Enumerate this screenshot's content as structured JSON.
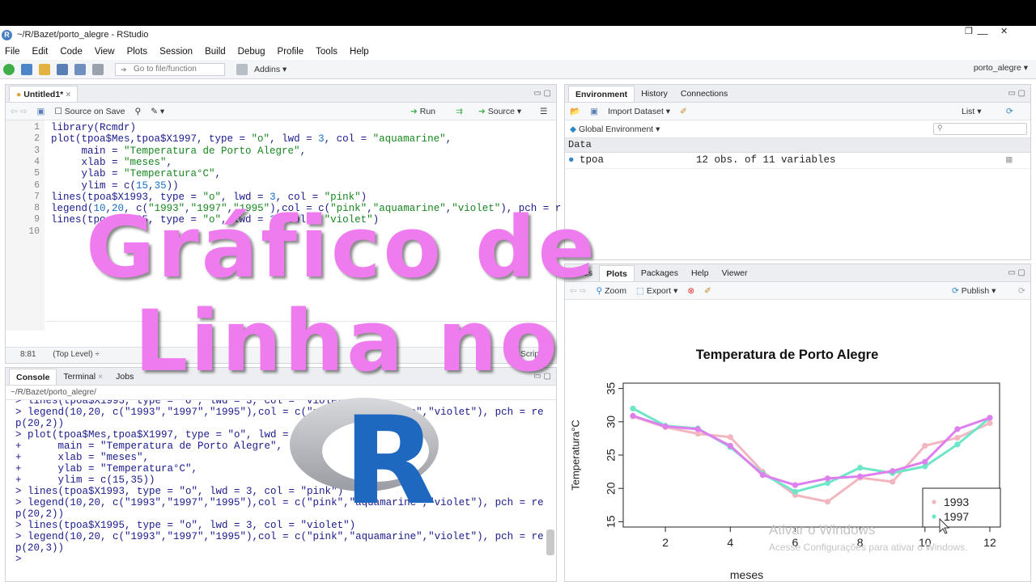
{
  "window": {
    "title": "~/R/Bazet/porto_alegre - RStudio",
    "minimize": "—",
    "maximize": "❐",
    "close": "✕"
  },
  "menu": [
    "File",
    "Edit",
    "Code",
    "View",
    "Plots",
    "Session",
    "Build",
    "Debug",
    "Profile",
    "Tools",
    "Help"
  ],
  "toolbar": {
    "goto_placeholder": "Go to file/function",
    "addins": "Addins ▾",
    "project": "porto_alegre ▾"
  },
  "editor": {
    "tab": "Untitled1*",
    "source_on_save": "Source on Save",
    "run": "Run",
    "source": "Source ▾",
    "lines": [
      {
        "n": "1",
        "code": "library(Rcmdr)"
      },
      {
        "n": "2",
        "code": "plot(tpoa$Mes,tpoa$X1997, type = \"o\", lwd = 3, col = \"aquamarine\","
      },
      {
        "n": "3",
        "code": "     main = \"Temperatura de Porto Alegre\","
      },
      {
        "n": "4",
        "code": "     xlab = \"meses\","
      },
      {
        "n": "5",
        "code": "     ylab = \"Temperatura°C\","
      },
      {
        "n": "6",
        "code": "     ylim = c(15,35))"
      },
      {
        "n": "7",
        "code": "lines(tpoa$X1993, type = \"o\", lwd = 3, col = \"pink\")"
      },
      {
        "n": "8",
        "code": "legend(10,20, c(\"1993\",\"1997\",\"1995\"),col = c(\"pink\",\"aquamarine\",\"violet\"), pch = r"
      },
      {
        "n": "9",
        "code": "lines(tpoa$X1995, type = \"o\", lwd = 3, col = \"violet\")"
      },
      {
        "n": "10",
        "code": ""
      }
    ],
    "status_pos": "8:81",
    "status_scope": "(Top Level) ÷",
    "status_type": "R Script ÷"
  },
  "console": {
    "tabs": [
      "Console",
      "Terminal",
      "Jobs"
    ],
    "path": "~/R/Bazet/porto_alegre/",
    "lines": [
      "> lines(tpoa$X1993, type = \"o\", lwd = 3, col = \"violet\")",
      "> legend(10,20, c(\"1993\",\"1997\",\"1995\"),col = c(\"pink\",\"aquamarine\",\"violet\"), pch = re",
      "p(20,2))",
      "> plot(tpoa$Mes,tpoa$X1997, type = \"o\", lwd = 3, col = \"aquamarine\",",
      "+      main = \"Temperatura de Porto Alegre\",",
      "+      xlab = \"meses\",",
      "+      ylab = \"Temperatura°C\",",
      "+      ylim = c(15,35))",
      "> lines(tpoa$X1993, type = \"o\", lwd = 3, col = \"pink\")",
      "> legend(10,20, c(\"1993\",\"1997\",\"1995\"),col = c(\"pink\",\"aquamarine\",\"violet\"), pch = re",
      "p(20,2))",
      "> lines(tpoa$X1995, type = \"o\", lwd = 3, col = \"violet\")",
      "> legend(10,20, c(\"1993\",\"1997\",\"1995\"),col = c(\"pink\",\"aquamarine\",\"violet\"), pch = re",
      "p(20,3))",
      "> "
    ]
  },
  "environment": {
    "tabs": [
      "Environment",
      "History",
      "Connections"
    ],
    "import": "Import Dataset ▾",
    "list": "List ▾",
    "scope": "Global Environment ▾",
    "section": "Data",
    "rows": [
      {
        "name": "tpoa",
        "value": "12 obs. of 11 variables"
      }
    ]
  },
  "files": {
    "tabs": [
      "Files",
      "Plots",
      "Packages",
      "Help",
      "Viewer"
    ],
    "zoom": "Zoom",
    "export": "Export ▾",
    "publish": "Publish ▾"
  },
  "overlay": {
    "line1": "Gráfico de",
    "line2": "Linha no",
    "r_logo": "R"
  },
  "watermark": {
    "line1": "Ativar o Windows",
    "line2": "Acesse Configurações para ativar o Windows."
  },
  "colors": {
    "pink": "#f2b6c0",
    "aquamarine": "#6fe6c8",
    "violet": "#dd80ee",
    "overlay": "#ee7cee",
    "r_blue": "#1f68c0"
  },
  "chart_data": {
    "type": "line",
    "title": "Temperatura de Porto Alegre",
    "xlabel": "meses",
    "ylabel": "Temperatura°C",
    "x": [
      1,
      2,
      3,
      4,
      5,
      6,
      7,
      8,
      9,
      10,
      11,
      12
    ],
    "xlim": [
      1,
      12
    ],
    "ylim": [
      15,
      35
    ],
    "xticks": [
      2,
      4,
      6,
      8,
      10,
      12
    ],
    "yticks": [
      15,
      20,
      25,
      30,
      35
    ],
    "series": [
      {
        "name": "1993",
        "color": "#f2b6c0",
        "values": [
          30.8,
          29.2,
          28.2,
          27.7,
          22.5,
          19.0,
          18.0,
          21.6,
          21.0,
          26.4,
          27.6,
          29.8
        ]
      },
      {
        "name": "1997",
        "color": "#6fe6c8",
        "values": [
          32.0,
          29.4,
          29.0,
          26.2,
          22.2,
          19.5,
          20.8,
          23.1,
          22.3,
          23.3,
          26.6,
          30.6
        ]
      },
      {
        "name": "",
        "color": "#dd80ee",
        "values": [
          30.9,
          29.3,
          28.9,
          26.4,
          22.0,
          20.5,
          21.5,
          21.8,
          22.6,
          24.0,
          28.9,
          30.6
        ]
      }
    ],
    "legend": {
      "position": "bottom-right",
      "entries": [
        "1993",
        "1997"
      ]
    },
    "grid": false
  }
}
